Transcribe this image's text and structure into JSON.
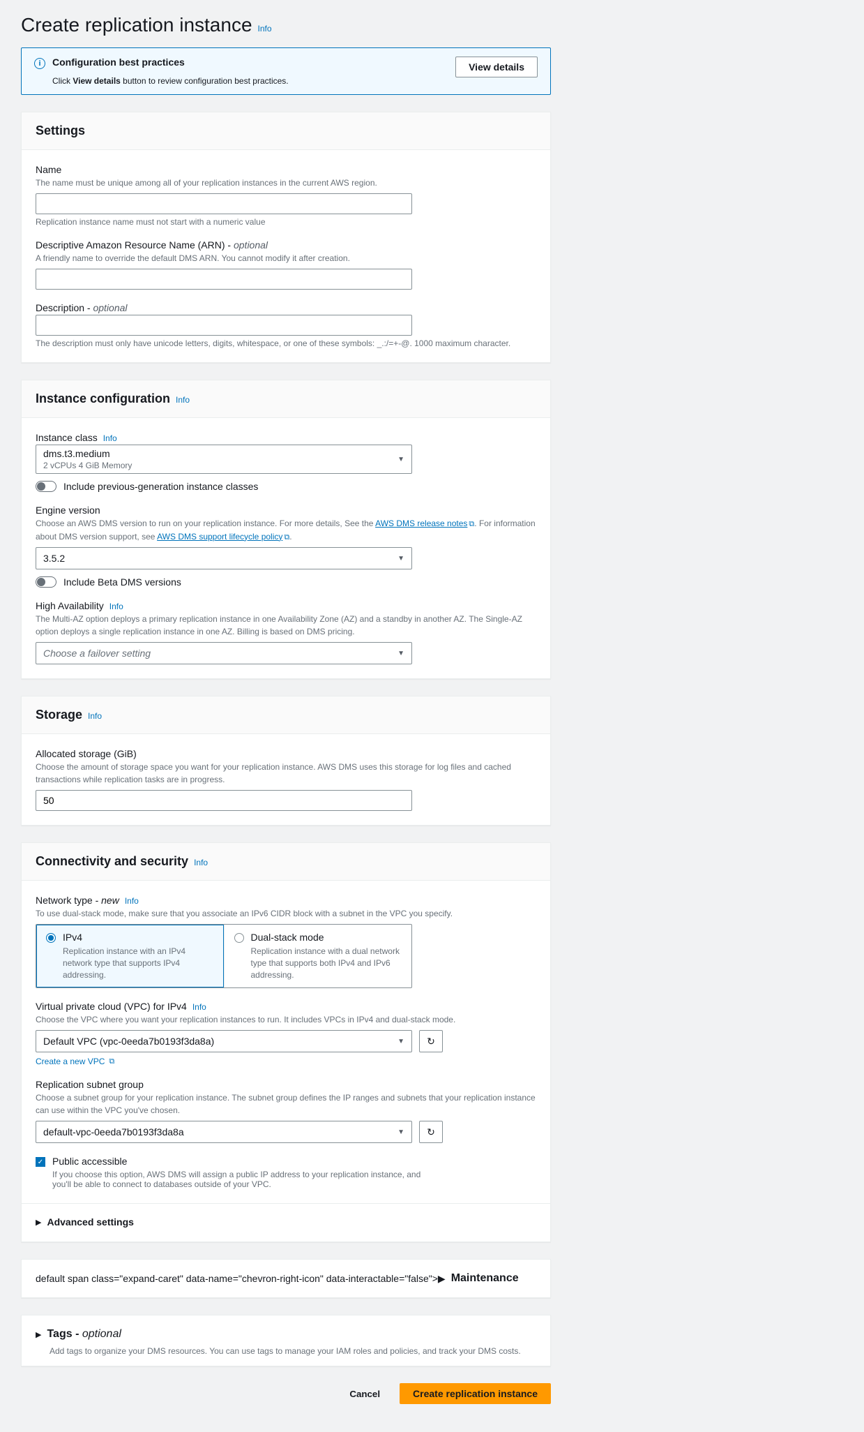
{
  "page": {
    "title": "Create replication instance",
    "info_label": "Info"
  },
  "banner": {
    "title": "Configuration best practices",
    "desc_pre": "Click ",
    "desc_bold": "View details",
    "desc_post": " button to review configuration best practices.",
    "button": "View details"
  },
  "settings": {
    "header": "Settings",
    "name": {
      "label": "Name",
      "desc": "The name must be unique among all of your replication instances in the current AWS region.",
      "hint": "Replication instance name must not start with a numeric value"
    },
    "arn": {
      "label": "Descriptive Amazon Resource Name (ARN) - ",
      "optional": "optional",
      "desc": "A friendly name to override the default DMS ARN. You cannot modify it after creation."
    },
    "description": {
      "label": "Description - ",
      "optional": "optional",
      "hint": "The description must only have unicode letters, digits, whitespace, or one of these symbols: _.:/=+-@. 1000 maximum character."
    }
  },
  "instance_config": {
    "header": "Instance configuration",
    "info": "Info",
    "class": {
      "label": "Instance class",
      "info": "Info",
      "value": "dms.t3.medium",
      "sub": "2 vCPUs     4 GiB Memory",
      "toggle": "Include previous-generation instance classes"
    },
    "engine": {
      "label": "Engine version",
      "desc_1": "Choose an AWS DMS version to run on your replication instance. For more details, See the ",
      "link_1": "AWS DMS release notes",
      "desc_2": ". For information about DMS version support, see ",
      "link_2": "AWS DMS support lifecycle policy",
      "desc_3": ".",
      "value": "3.5.2",
      "toggle": "Include Beta DMS versions"
    },
    "ha": {
      "label": "High Availability",
      "info": "Info",
      "desc": "The Multi-AZ option deploys a primary replication instance in one Availability Zone (AZ) and a standby in another AZ. The Single-AZ option deploys a single replication instance in one AZ. Billing is based on DMS pricing.",
      "placeholder": "Choose a failover setting"
    }
  },
  "storage": {
    "header": "Storage",
    "info": "Info",
    "allocated": {
      "label": "Allocated storage (GiB)",
      "desc": "Choose the amount of storage space you want for your replication instance. AWS DMS uses this storage for log files and cached transactions while replication tasks are in progress.",
      "value": "50"
    }
  },
  "connectivity": {
    "header": "Connectivity and security",
    "info": "Info",
    "network": {
      "label": "Network type - ",
      "new_badge": "new",
      "info": "Info",
      "desc": "To use dual-stack mode, make sure that you associate an IPv6 CIDR block with a subnet in the VPC you specify.",
      "ipv4_title": "IPv4",
      "ipv4_desc": "Replication instance with an IPv4 network type that supports IPv4 addressing.",
      "dual_title": "Dual-stack mode",
      "dual_desc": "Replication instance with a dual network type that supports both IPv4 and IPv6 addressing."
    },
    "vpc": {
      "label": "Virtual private cloud (VPC) for IPv4",
      "info": "Info",
      "desc": "Choose the VPC where you want your replication instances to run. It includes VPCs in IPv4 and dual-stack mode.",
      "value": "Default VPC (vpc-0eeda7b0193f3da8a)",
      "create_link": "Create a new VPC"
    },
    "subnet": {
      "label": "Replication subnet group",
      "desc": "Choose a subnet group for your replication instance. The subnet group defines the IP ranges and subnets that your replication instance can use within the VPC you've chosen.",
      "value": "default-vpc-0eeda7b0193f3da8a"
    },
    "public": {
      "label": "Public accessible",
      "desc": "If you choose this option, AWS DMS will assign a public IP address to your replication instance, and you'll be able to connect to databases outside of your VPC."
    },
    "advanced": "Advanced settings"
  },
  "maintenance": {
    "header": "Maintenance"
  },
  "tags": {
    "header": "Tags - ",
    "optional": "optional",
    "desc": "Add tags to organize your DMS resources. You can use tags to manage your IAM roles and policies, and track your DMS costs."
  },
  "footer": {
    "cancel": "Cancel",
    "create": "Create replication instance"
  }
}
